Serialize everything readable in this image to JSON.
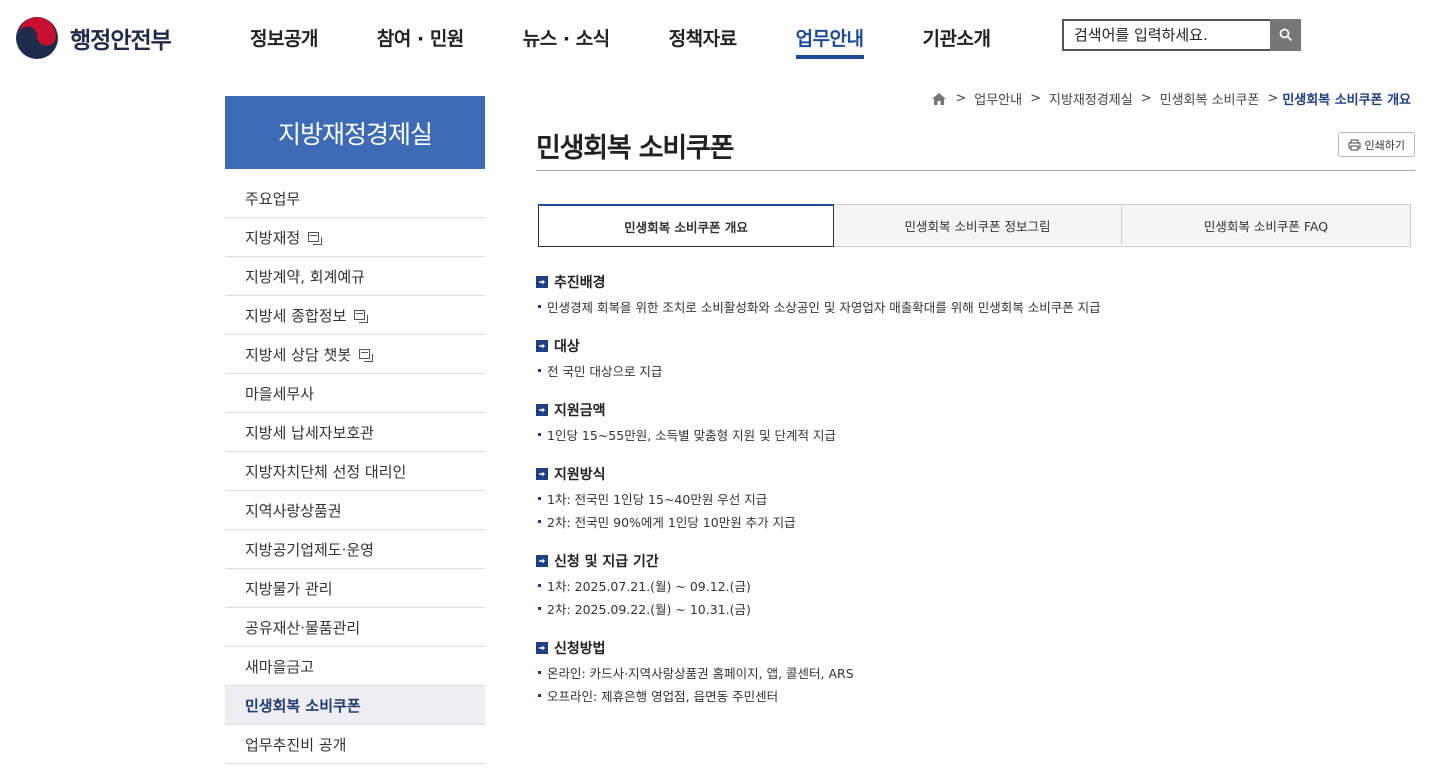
{
  "logo": {
    "text": "행정안전부"
  },
  "gnb": [
    {
      "label": "정보공개"
    },
    {
      "label": "참여 · 민원"
    },
    {
      "label": "뉴스 · 소식"
    },
    {
      "label": "정책자료"
    },
    {
      "label": "업무안내",
      "active": true
    },
    {
      "label": "기관소개"
    }
  ],
  "search": {
    "placeholder": "검색어를 입력하세요."
  },
  "sidebar": {
    "title": "지방재정경제실",
    "items": [
      {
        "label": "주요업무"
      },
      {
        "label": "지방재정",
        "window": true
      },
      {
        "label": "지방계약, 회계예규"
      },
      {
        "label": "지방세 종합정보",
        "window": true
      },
      {
        "label": "지방세 상담 챗봇",
        "window": true
      },
      {
        "label": "마을세무사"
      },
      {
        "label": "지방세 납세자보호관"
      },
      {
        "label": "지방자치단체 선정 대리인"
      },
      {
        "label": "지역사랑상품권"
      },
      {
        "label": "지방공기업제도·운영"
      },
      {
        "label": "지방물가 관리"
      },
      {
        "label": "공유재산·물품관리"
      },
      {
        "label": "새마을금고"
      },
      {
        "label": "민생회복 소비쿠폰",
        "active": true
      },
      {
        "label": "업무추진비 공개"
      }
    ]
  },
  "breadcrumb": {
    "items": [
      "업무안내",
      "지방재정경제실",
      "민생회복 소비쿠폰"
    ],
    "current": "민생회복 소비쿠폰 개요"
  },
  "page": {
    "title": "민생회복 소비쿠폰",
    "print_label": "인쇄하기"
  },
  "tabs": [
    {
      "label": "민생회복 소비쿠폰 개요",
      "active": true
    },
    {
      "label": "민생회복 소비쿠폰 정보그림"
    },
    {
      "label": "민생회복 소비쿠폰 FAQ"
    }
  ],
  "sections": [
    {
      "title": "추진배경",
      "lines": [
        "민생경제 회복을 위한 조치로 소비활성화와 소상공인 및 자영업자 매출확대를 위해 민생회복 소비쿠폰 지급"
      ]
    },
    {
      "title": "대상",
      "lines": [
        "전 국민 대상으로 지급"
      ]
    },
    {
      "title": "지원금액",
      "lines": [
        "1인당 15~55만원, 소득별 맞춤형 지원 및 단계적 지급"
      ]
    },
    {
      "title": "지원방식",
      "lines": [
        "1차: 전국민 1인당 15~40만원 우선 지급",
        "2차: 전국민 90%에게 1인당 10만원 추가 지급"
      ]
    },
    {
      "title": "신청 및 지급 기간",
      "lines": [
        "1차: 2025.07.21.(월) ~ 09.12.(금)",
        "2차: 2025.09.22.(월) ~ 10.31.(금)"
      ]
    },
    {
      "title": "신청방법",
      "lines": [
        "온라인: 카드사·지역사랑상품권 홈페이지, 앱, 콜센터, ARS",
        "오프라인: 제휴은행 영업점, 읍면동 주민센터"
      ]
    }
  ],
  "colors": {
    "primary": "#1d4c9a",
    "sidebar_title_bg": "#3d6bb6",
    "accent_dark": "#1d3f86"
  }
}
